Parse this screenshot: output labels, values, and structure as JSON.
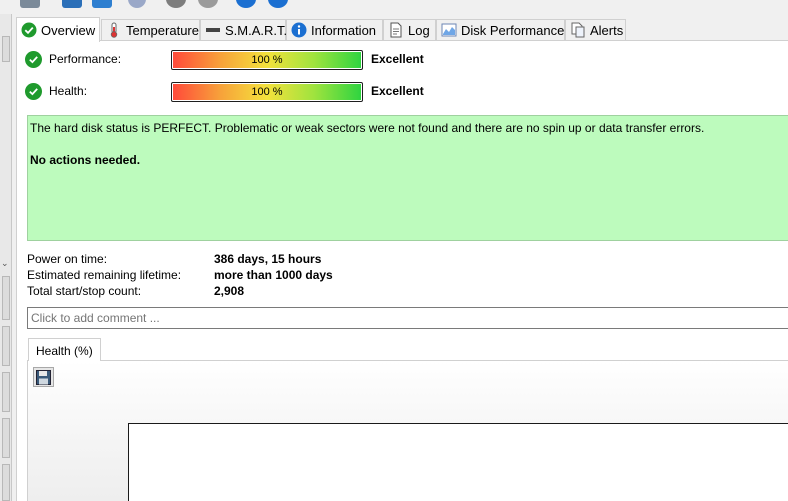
{
  "tabs": [
    {
      "label": "Overview",
      "icon": "check-circle-icon",
      "active": true
    },
    {
      "label": "Temperature",
      "icon": "thermometer-icon"
    },
    {
      "label": "S.M.A.R.T.",
      "icon": "smart-bar-icon"
    },
    {
      "label": "Information",
      "icon": "info-icon"
    },
    {
      "label": "Log",
      "icon": "document-icon"
    },
    {
      "label": "Disk Performance",
      "icon": "chart-icon"
    },
    {
      "label": "Alerts",
      "icon": "alerts-icon"
    }
  ],
  "performance": {
    "label": "Performance:",
    "value": "100 %",
    "percent": 100,
    "rating": "Excellent"
  },
  "health": {
    "label": "Health:",
    "value": "100 %",
    "percent": 100,
    "rating": "Excellent"
  },
  "status": {
    "message": "The hard disk status is PERFECT. Problematic or weak sectors were not found and there are no spin up or data transfer errors.",
    "action": "No actions needed."
  },
  "info": [
    {
      "key": "Power on time:",
      "value": "386 days, 15 hours"
    },
    {
      "key": "Estimated remaining lifetime:",
      "value": "more than 1000 days"
    },
    {
      "key": "Total start/stop count:",
      "value": "2,908"
    }
  ],
  "comment": {
    "placeholder": "Click to add comment ..."
  },
  "graph_tabs": [
    {
      "label": "Health (%)"
    }
  ],
  "colors": {
    "status_bg": "#bdfbbd",
    "ok_green": "#1f9a2d",
    "info_blue": "#1b6fd1"
  }
}
